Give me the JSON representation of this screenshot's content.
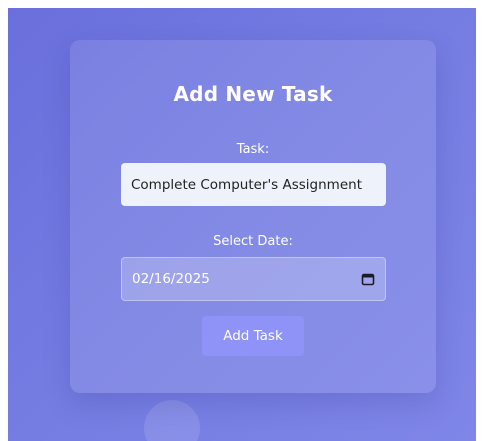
{
  "form": {
    "title": "Add New Task",
    "task_label": "Task:",
    "task_value": "Complete Computer's Assignment",
    "date_label": "Select Date:",
    "date_value": "02/16/2025",
    "submit_label": "Add Task"
  },
  "colors": {
    "background": "#7077e0",
    "input_bg": "#eef2fb",
    "button_bg": "#8f92f7",
    "text": "#ffffff"
  },
  "icons": {
    "date_picker": "calendar-icon"
  }
}
